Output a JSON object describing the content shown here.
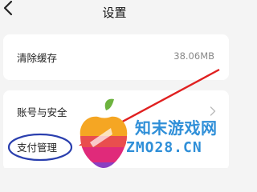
{
  "header": {
    "title": "设置",
    "back_icon": "back-chevron-icon"
  },
  "cache_card": {
    "label": "清除缓存",
    "value": "38.06MB"
  },
  "account_card": {
    "items": [
      {
        "label": "账号与安全",
        "icon": "chevron-right-icon"
      },
      {
        "label": "支付管理"
      }
    ]
  },
  "watermark": {
    "cn_text": "知末游戏网",
    "en_text": "ZMO28.CN",
    "logo": "apple-logo"
  },
  "annotations": {
    "arrow_color": "#e02020",
    "circle_color": "#2a3fae"
  },
  "colors": {
    "background": "#f4f4f4",
    "card": "#ffffff",
    "watermark_blue": "#2f8fd8"
  }
}
